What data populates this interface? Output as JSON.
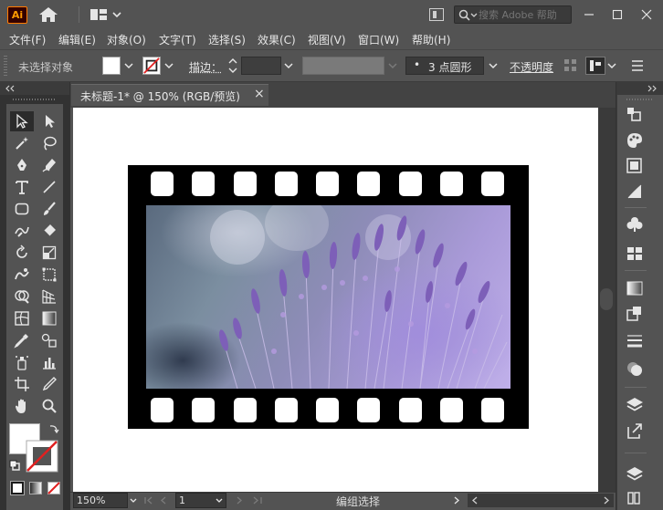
{
  "app": {
    "logo_text": "Ai",
    "search_placeholder": "搜索 Adobe 帮助"
  },
  "menu": {
    "items": [
      "文件(F)",
      "编辑(E)",
      "对象(O)",
      "文字(T)",
      "选择(S)",
      "效果(C)",
      "视图(V)",
      "窗口(W)",
      "帮助(H)"
    ]
  },
  "control_bar": {
    "selection_status": "未选择对象",
    "stroke_label": "描边：",
    "brush_value": "3 点圆形",
    "brush_bullet": "•",
    "opacity_label": "不透明度"
  },
  "document": {
    "tab_title": "未标题-1* @ 150% (RGB/预览)",
    "tab_close": "×"
  },
  "status_bar": {
    "zoom": "150%",
    "page": "1",
    "tool_status": "编组选择"
  },
  "colors": {
    "ui_dark": "#535353",
    "panel_bg": "#323232",
    "accent_ai": "#ff9a00",
    "film_black": "#000000",
    "canvas": "#ffffff"
  }
}
